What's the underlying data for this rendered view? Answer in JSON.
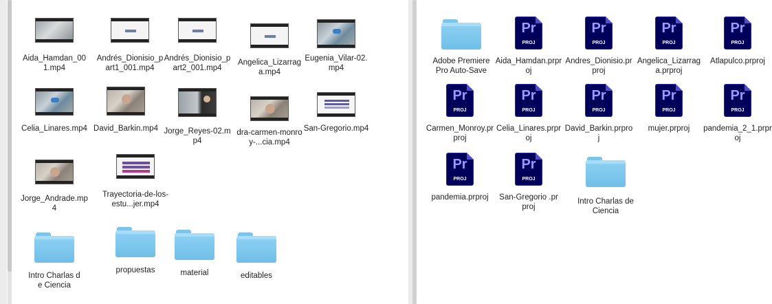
{
  "left_window": {
    "items": [
      {
        "label": "Aida_Hamdan_001.mp4",
        "icon": "video-thumbnail"
      },
      {
        "label": "Andrés_Dionisio_part1_001.mp4",
        "icon": "video-thumbnail"
      },
      {
        "label": "Andrés_Dionisio_part2_001.mp4",
        "icon": "video-thumbnail"
      },
      {
        "label": "Angelica_Lizarraga.mp4",
        "icon": "video-thumbnail"
      },
      {
        "label": "Eugenia_Vilar-02.mp4",
        "icon": "video-thumbnail"
      },
      {
        "label": "Celia_Linares.mp4",
        "icon": "video-thumbnail"
      },
      {
        "label": "David_Barkin.mp4",
        "icon": "video-thumbnail"
      },
      {
        "label": "Jorge_Reyes-02.mp4",
        "icon": "video-thumbnail"
      },
      {
        "label": "dra-carmen-monroy-...cia.mp4",
        "icon": "video-thumbnail"
      },
      {
        "label": "San-Gregorio.mp4",
        "icon": "video-thumbnail"
      },
      {
        "label": "Jorge_Andrade.mp4",
        "icon": "video-thumbnail"
      },
      {
        "label": "Trayectoria-de-los-estu...jer.mp4",
        "icon": "video-thumbnail"
      },
      {
        "label": "Intro Charlas de Ciencia",
        "icon": "folder-icon"
      },
      {
        "label": "propuestas",
        "icon": "folder-icon"
      },
      {
        "label": "material",
        "icon": "folder-icon"
      },
      {
        "label": "editables",
        "icon": "folder-icon"
      }
    ]
  },
  "right_window": {
    "items": [
      {
        "label": "Adobe Premiere Pro Auto-Save",
        "icon": "folder-icon"
      },
      {
        "label": "Aida_Hamdan.prproj",
        "icon": "premiere-project-icon"
      },
      {
        "label": "Andres_Dionisio.prproj",
        "icon": "premiere-project-icon"
      },
      {
        "label": "Angelica_Lizarraga.prproj",
        "icon": "premiere-project-icon"
      },
      {
        "label": "Atlapulco.prproj",
        "icon": "premiere-project-icon"
      },
      {
        "label": "Carmen_Monroy.prproj",
        "icon": "premiere-project-icon"
      },
      {
        "label": "Celia_Linares.prproj",
        "icon": "premiere-project-icon"
      },
      {
        "label": "David_Barkin.prproj",
        "icon": "premiere-project-icon"
      },
      {
        "label": "mujer.prproj",
        "icon": "premiere-project-icon"
      },
      {
        "label": "pandemia_2_1.prproj",
        "icon": "premiere-project-icon"
      },
      {
        "label": "pandemia.prproj",
        "icon": "premiere-project-icon"
      },
      {
        "label": "San-Gregorio .prproj",
        "icon": "premiere-project-icon"
      },
      {
        "label": "Intro Charlas de Ciencia",
        "icon": "folder-icon"
      }
    ]
  },
  "premiere_icon": {
    "logo": "Pr",
    "badge": "PROJ"
  },
  "colors": {
    "folder": "#7cc4ea",
    "premiere_bg": "#00005b",
    "premiere_text": "#9999ff"
  }
}
